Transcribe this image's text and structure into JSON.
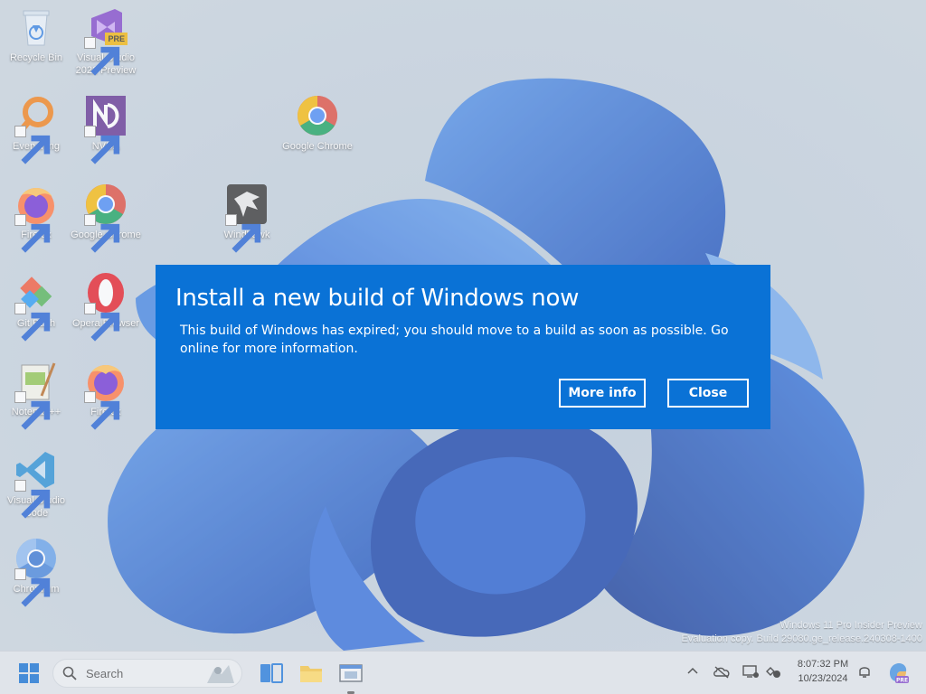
{
  "desktop": {
    "icons": [
      {
        "label": "Recycle Bin",
        "icon": "recycle-bin-icon"
      },
      {
        "label": "Visual Studio 2022 Preview",
        "icon": "visual-studio-preview-icon",
        "badge": "PRE"
      },
      {
        "label": "Everything",
        "icon": "everything-search-icon"
      },
      {
        "label": "NVDA",
        "icon": "nvda-icon"
      },
      {
        "label": "Google Chrome",
        "icon": "chrome-icon"
      },
      {
        "label": "Firefox",
        "icon": "firefox-icon"
      },
      {
        "label": "Google Chrome",
        "icon": "chrome-icon"
      },
      {
        "label": "Windhawk",
        "icon": "windhawk-icon"
      },
      {
        "label": "Git Bash",
        "icon": "git-bash-icon"
      },
      {
        "label": "Opera Browser",
        "icon": "opera-icon"
      },
      {
        "label": "Notepad++",
        "icon": "notepadpp-icon"
      },
      {
        "label": "Firefox",
        "icon": "firefox-icon"
      },
      {
        "label": "Visual Studio Code",
        "icon": "vscode-icon"
      },
      {
        "label": "Chromium",
        "icon": "chromium-icon"
      }
    ]
  },
  "dialog": {
    "title": "Install a new build of Windows now",
    "body": "This build of Windows has expired; you should move to a build as soon as possible. Go online for more information.",
    "more_info_label": "More info",
    "close_label": "Close",
    "background_color": "#0a72d6"
  },
  "watermark": {
    "line1": "Windows 11 Pro Insider Preview",
    "line2": "Evaluation copy. Build 29080.ge_release.240308-1400"
  },
  "taskbar": {
    "search_label": "Search",
    "time": "8:07:32 PM",
    "date": "10/23/2024",
    "pinned": [
      "start-icon",
      "task-view-icon",
      "file-explorer-icon",
      "app-window-icon"
    ],
    "tray": [
      "chevron-up-icon",
      "onedrive-icon",
      "network-icon",
      "focus-icon",
      "notification-bell-icon",
      "copilot-icon"
    ]
  }
}
